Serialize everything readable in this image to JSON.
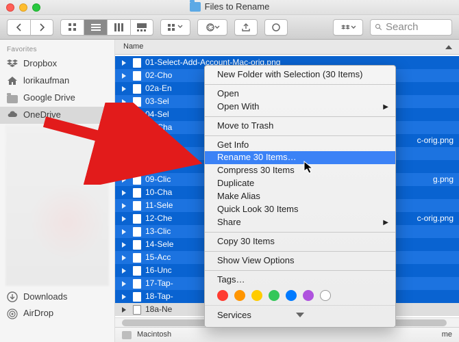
{
  "window": {
    "title": "Files to Rename"
  },
  "toolbar": {
    "search_placeholder": "Search"
  },
  "sidebar": {
    "heading": "Favorites",
    "items": [
      {
        "label": "Dropbox",
        "icon": "dropbox-icon"
      },
      {
        "label": "lorikaufman",
        "icon": "home-icon"
      },
      {
        "label": "Google Drive",
        "icon": "folder-icon"
      },
      {
        "label": "OneDrive",
        "icon": "cloud-icon",
        "selected": true
      }
    ],
    "bottom_items": [
      {
        "label": "Downloads",
        "icon": "downloads-icon"
      },
      {
        "label": "AirDrop",
        "icon": "airdrop-icon"
      }
    ]
  },
  "list": {
    "column": "Name",
    "rows": [
      "01-Select-Add-Account-Mac-orig.png",
      "02-Cho",
      "02a-En",
      "03-Sel",
      "04-Sel",
      "05-Cha",
      "06-Ema",
      "07-Cho",
      "08-Clic",
      "09-Clic",
      "10-Cha",
      "11-Sele",
      "12-Che",
      "13-Clic",
      "14-Sele",
      "15-Acc",
      "16-Unc",
      "17-Tap-",
      "18-Tap-",
      "18a-Ne"
    ],
    "suffixes": {
      "6": "c-orig.png",
      "9": "g.png",
      "12": "c-orig.png"
    }
  },
  "pathbar": {
    "device": "Macintosh",
    "end": "me"
  },
  "menu": {
    "items": [
      {
        "label": "New Folder with Selection (30 Items)"
      },
      {
        "sep": true
      },
      {
        "label": "Open"
      },
      {
        "label": "Open With",
        "submenu": true
      },
      {
        "sep": true
      },
      {
        "label": "Move to Trash"
      },
      {
        "sep": true
      },
      {
        "label": "Get Info"
      },
      {
        "label": "Rename 30 Items…",
        "highlight": true
      },
      {
        "label": "Compress 30 Items"
      },
      {
        "label": "Duplicate"
      },
      {
        "label": "Make Alias"
      },
      {
        "label": "Quick Look 30 Items"
      },
      {
        "label": "Share",
        "submenu": true
      },
      {
        "sep": true
      },
      {
        "label": "Copy 30 Items"
      },
      {
        "sep": true
      },
      {
        "label": "Show View Options"
      },
      {
        "sep": true
      },
      {
        "label": "Tags…"
      }
    ],
    "last_item": "Services",
    "tag_colors": [
      "#ff3b30",
      "#ff9500",
      "#ffcc00",
      "#34c759",
      "#007aff",
      "#af52de",
      "#8e8e93"
    ]
  }
}
